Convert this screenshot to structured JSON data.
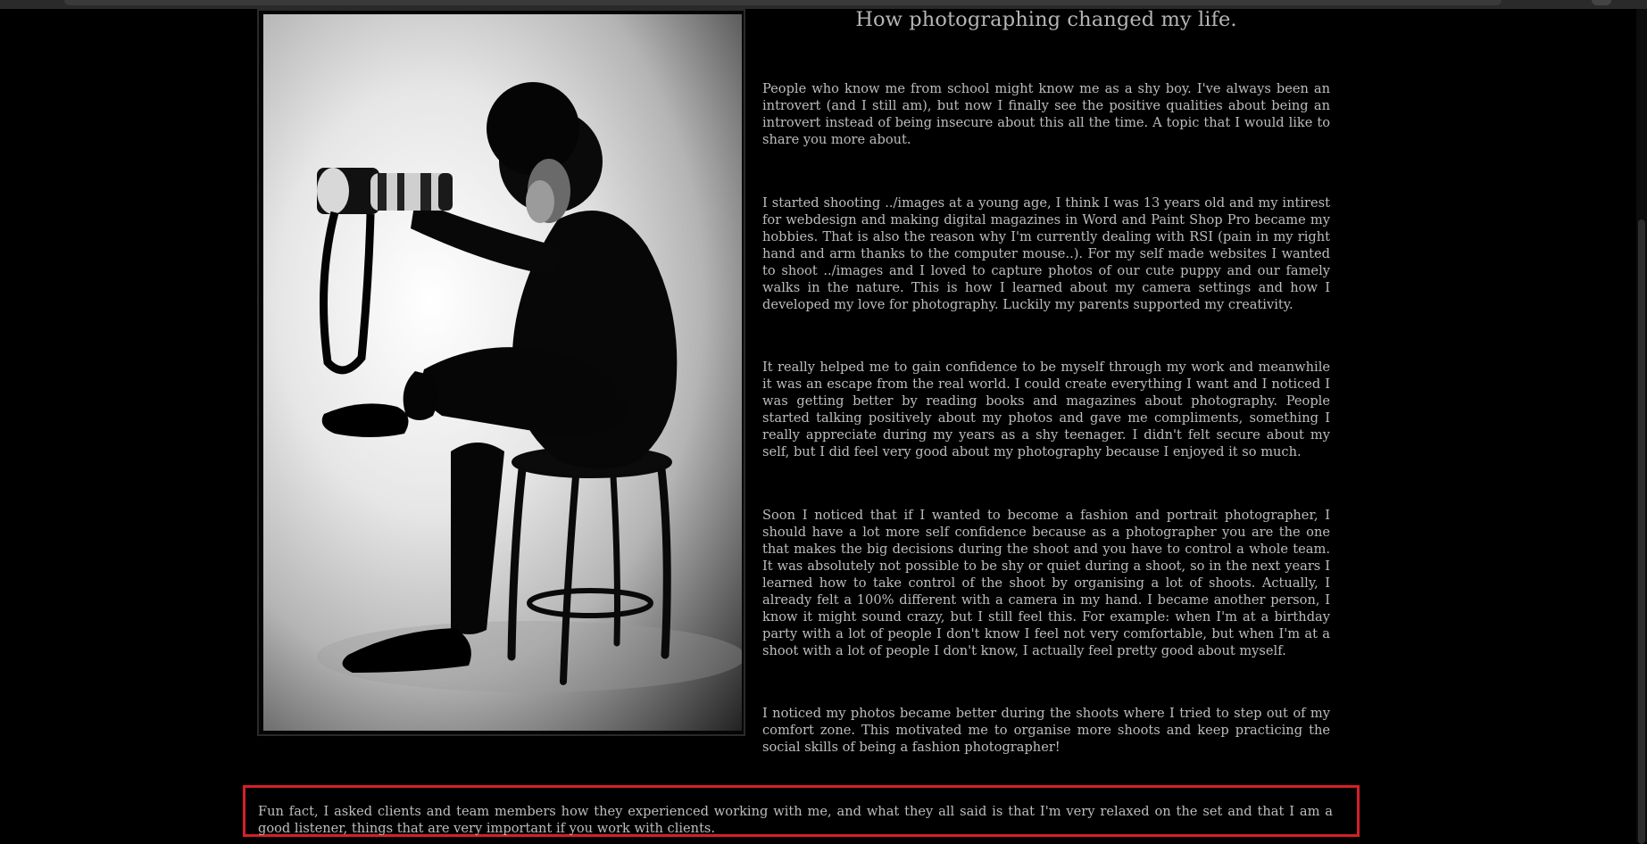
{
  "article": {
    "title": "How photographing changed my life.",
    "paragraphs": [
      "People who know me from school might know me as a shy boy. I've always been an introvert (and I still am), but now I finally see the positive qualities about being an introvert instead of being insecure about this all the time. A topic that I would like to share you more about.",
      "I started shooting ../images at a young age, I think I was 13 years old and my intirest for webdesign and making digital magazines in Word and Paint Shop Pro became my hobbies. That is also the reason why I'm currently dealing with RSI (pain in my right hand and arm thanks to the computer mouse..). For my self made websites I wanted to shoot ../images and I loved to capture photos of our cute puppy and our famely walks in the nature. This is how I learned about my camera settings and how I developed my love for photography. Luckily my parents supported my creativity.",
      "It really helped me to gain confidence to be myself through my work and meanwhile it was an escape from the real world. I could create everything I want and I noticed I was getting better by reading books and magazines about photography. People started talking positively about my photos and gave me compliments, something I really appreciate during my years as a shy teenager. I didn't felt secure about my self, but I did feel very good about my photography because I enjoyed it so much.",
      "Soon I noticed that if I wanted to become a fashion and portrait photographer, I should have a lot more self confidence because as a photographer you are the one that makes the big decisions during the shoot and you have to control a whole team. It was absolutely not possible to be shy or quiet during a shoot, so in the next years I learned how to take control of the shoot by organising a lot of shoots. Actually, I already felt a 100% different with a camera in my hand. I became another person, I know it might sound crazy, but I still feel this. For example: when I'm at a birthday party with a lot of people I don't know I feel not very comfortable, but when I'm at a shoot with a lot of people I don't know, I actually feel pretty good about myself.",
      "I noticed my photos became better during the shoots where I tried to step out of my comfort zone. This motivated me to organise more shoots and keep practicing the social skills of being a fashion photographer!"
    ],
    "fun_fact": "Fun fact, I asked clients and team members how they experienced working with me, and what they all said is that I'm very relaxed on the set and that I am a good listener, things that are very important if you work with clients."
  },
  "colors": {
    "background": "#000000",
    "text": "#bdbdbd",
    "highlight_border": "#d5202a"
  }
}
